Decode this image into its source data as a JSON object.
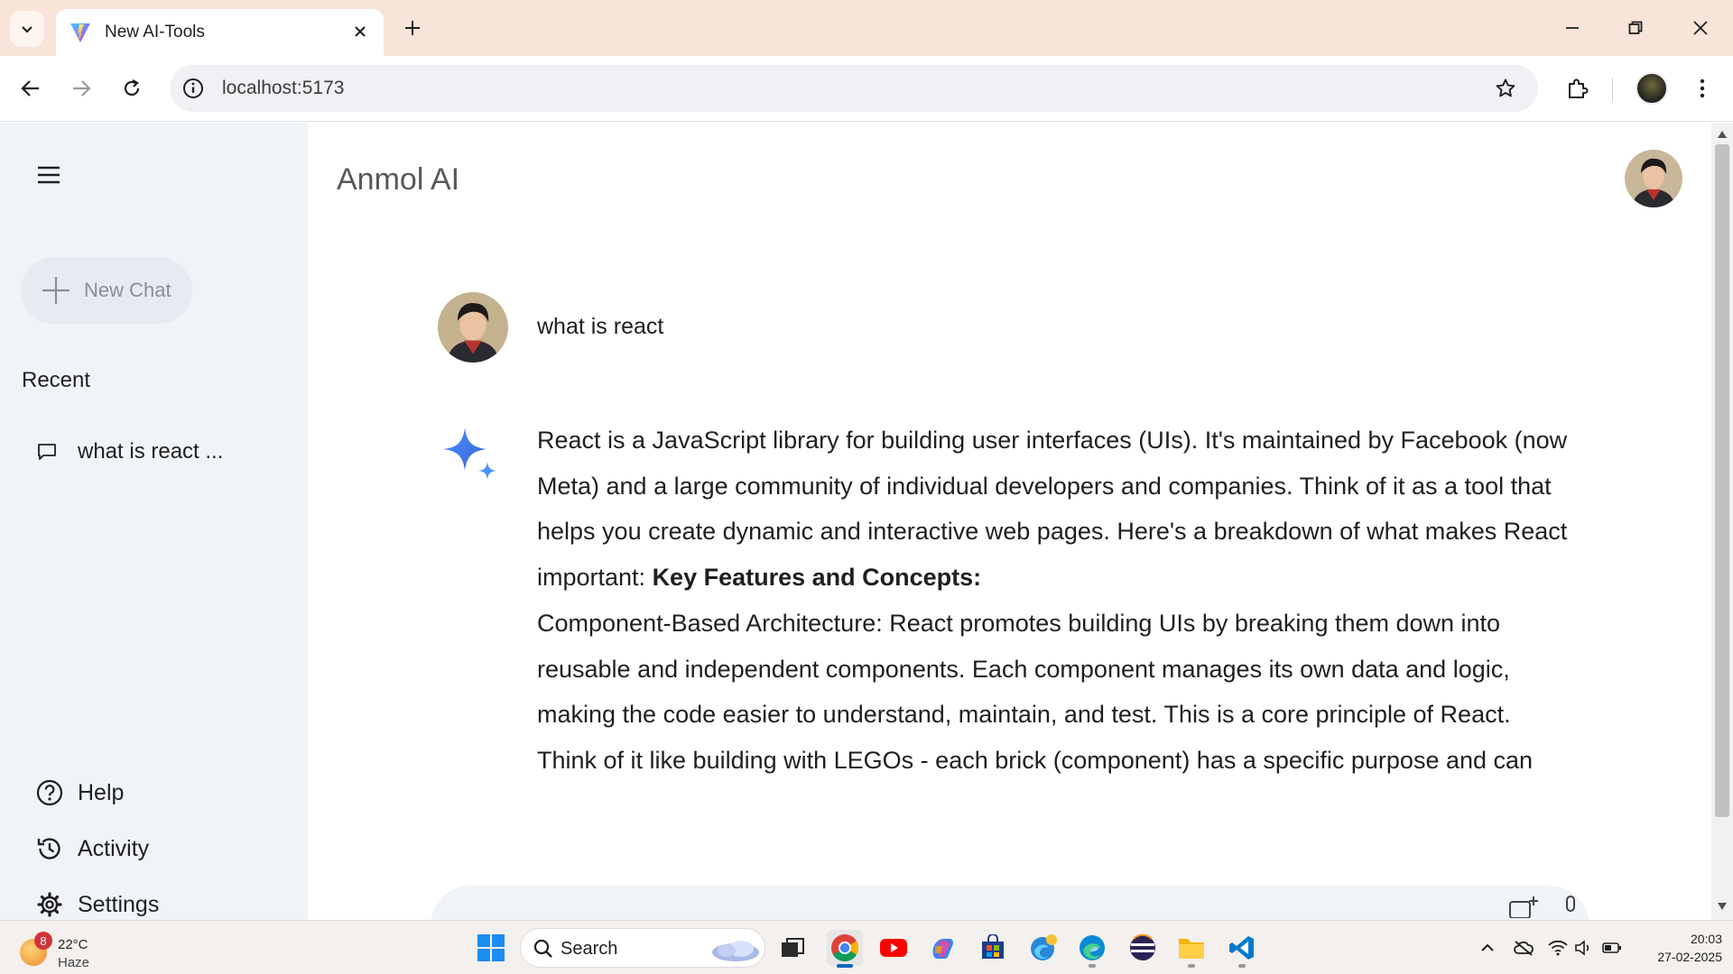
{
  "browser": {
    "tab_title": "New AI-Tools",
    "url": "localhost:5173"
  },
  "sidebar": {
    "new_chat_label": "New Chat",
    "recent_title": "Recent",
    "recent_items": [
      {
        "label": "what is react ..."
      }
    ],
    "bottom_items": [
      {
        "label": "Help",
        "icon": "help-circle-icon"
      },
      {
        "label": "Activity",
        "icon": "history-icon"
      },
      {
        "label": "Settings",
        "icon": "gear-icon"
      }
    ]
  },
  "main": {
    "app_title": "Anmol AI",
    "question": "what is react",
    "answer_intro": "React is a JavaScript library for building user interfaces (UIs). It's maintained by Facebook (now Meta) and a large community of individual developers and companies. Think of it as a tool that helps you create dynamic and interactive web pages. Here's a breakdown of what makes React important: ",
    "answer_heading": "Key Features and Concepts:",
    "answer_body": "Component-Based Architecture: React promotes building UIs by breaking them down into reusable and independent components. Each component manages its own data and logic, making the code easier to understand, maintain, and test. This is a core principle of React. Think of it like building with LEGOs - each brick (component) has a specific purpose and can"
  },
  "taskbar": {
    "weather_badge": "8",
    "weather_temp": "22°C",
    "weather_condition": "Haze",
    "search_label": "Search",
    "clock_time": "20:03",
    "clock_date": "27-02-2025"
  },
  "colors": {
    "tabstrip": "#f8e4d8",
    "sidebar": "#f0f4f9",
    "accent_blue": "#4285f4"
  }
}
